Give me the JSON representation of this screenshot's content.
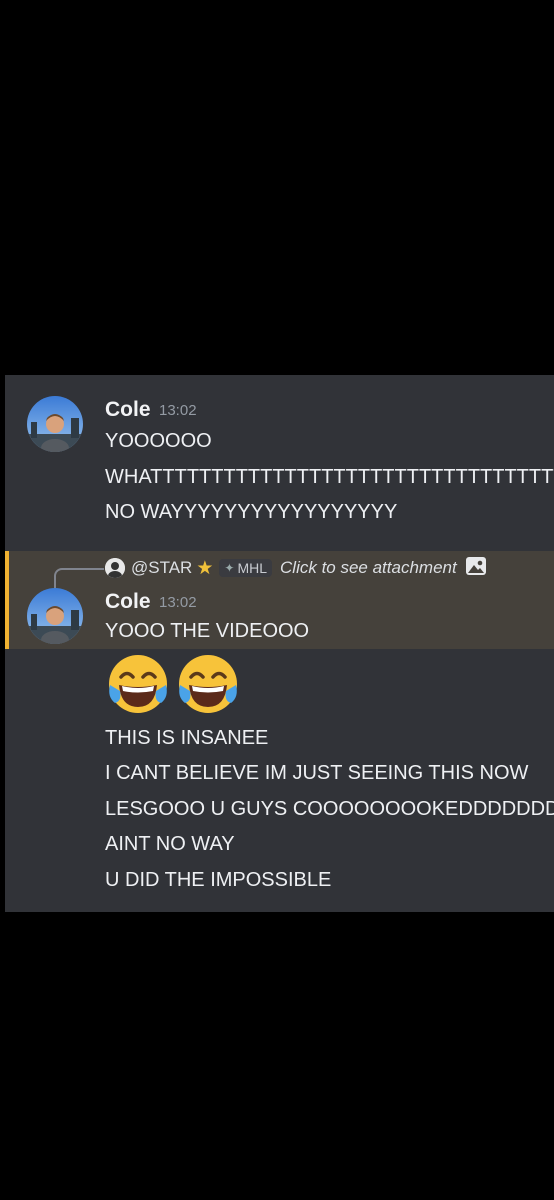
{
  "messages": [
    {
      "username": "Cole",
      "time": "13:02",
      "lines": [
        "YOOOOOO",
        "WHATTTTTTTTTTTTTTTTTTTTTTTTTTTTTTTTTTTTTTTTTT",
        "NO WAYYYYYYYYYYYYYYYYY"
      ]
    },
    {
      "reply": {
        "username": "@STAR",
        "star_icon": "star-icon",
        "tag": "MHL",
        "text": "Click to see attachment",
        "attachment_icon": "image-icon"
      },
      "username": "Cole",
      "time": "13:02",
      "line_first": "YOOO THE VIDEOOO",
      "emoji": [
        "face-with-tears-of-joy",
        "face-with-tears-of-joy"
      ],
      "lines": [
        "THIS IS INSANEE",
        "I CANT BELIEVE IM JUST SEEING THIS NOW",
        "LESGOOO U GUYS COOOOOOOOKEDDDDDDDDD",
        "AINT NO WAY",
        "U DID THE IMPOSSIBLE"
      ]
    }
  ],
  "colors": {
    "background": "#000000",
    "panel": "#313338",
    "reply_highlight": "#45413b",
    "reply_border": "#f0b232"
  }
}
